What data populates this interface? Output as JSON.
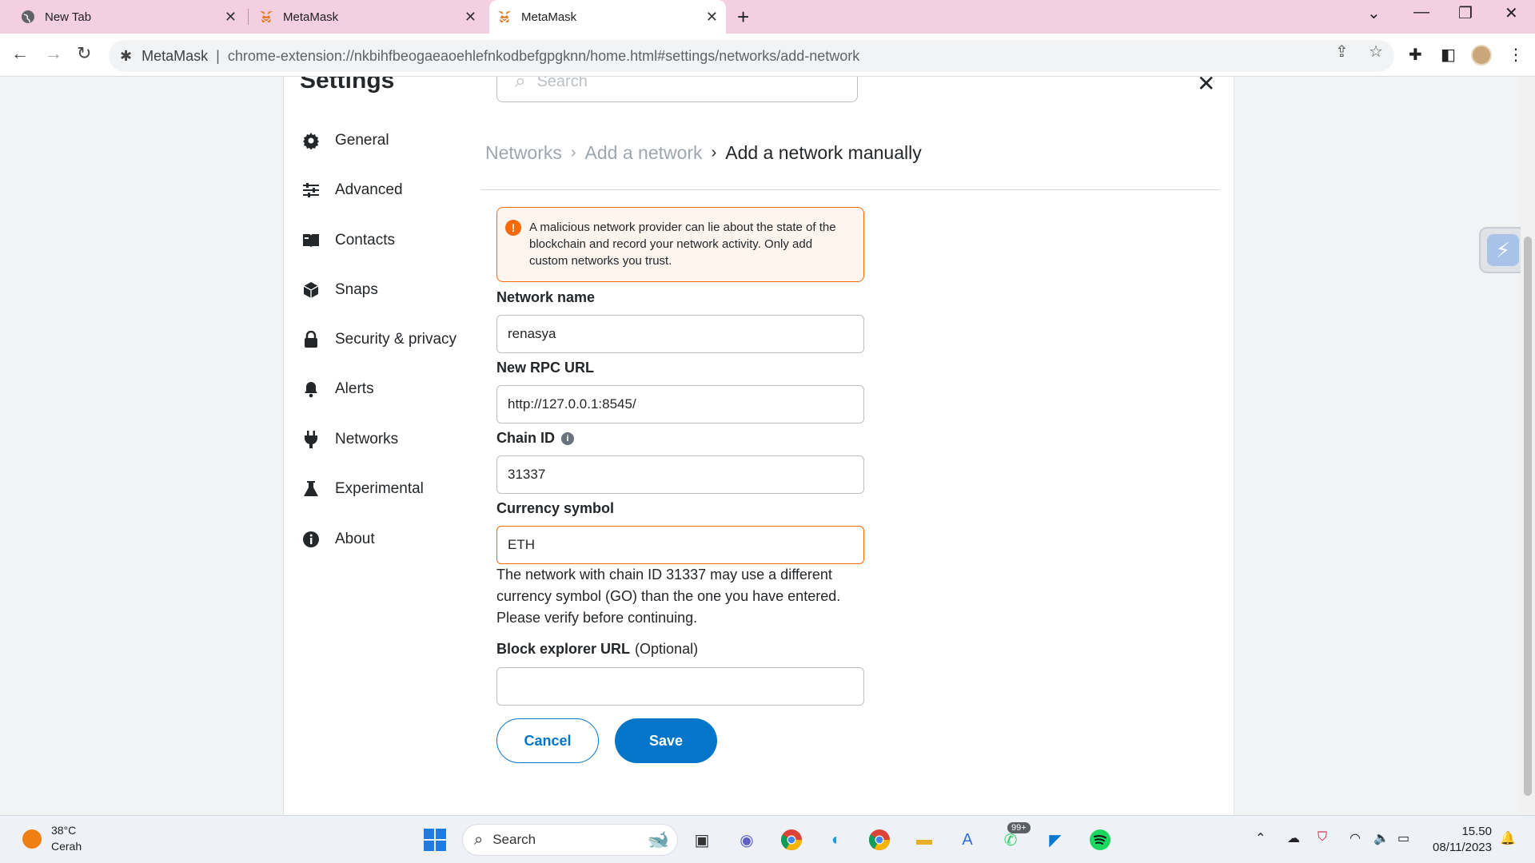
{
  "browser": {
    "tabs": [
      {
        "label": "New Tab"
      },
      {
        "label": "MetaMask"
      },
      {
        "label": "MetaMask"
      }
    ],
    "omnibox": {
      "site": "MetaMask",
      "url": "chrome-extension://nkbihfbeogaeaoehlefnkodbefgpgknn/home.html#settings/networks/add-network"
    }
  },
  "settings": {
    "title": "Settings",
    "search_placeholder": "Search",
    "nav": [
      {
        "label": "General",
        "icon": "gear-icon"
      },
      {
        "label": "Advanced",
        "icon": "sliders-icon"
      },
      {
        "label": "Contacts",
        "icon": "book-icon"
      },
      {
        "label": "Snaps",
        "icon": "cube-icon"
      },
      {
        "label": "Security & privacy",
        "icon": "lock-icon"
      },
      {
        "label": "Alerts",
        "icon": "bell-icon"
      },
      {
        "label": "Networks",
        "icon": "plug-icon"
      },
      {
        "label": "Experimental",
        "icon": "flask-icon"
      },
      {
        "label": "About",
        "icon": "info-icon"
      }
    ]
  },
  "breadcrumb": {
    "first": "Networks",
    "second": "Add a network",
    "current": "Add a network manually"
  },
  "warning": "A malicious network provider can lie about the state of the blockchain and record your network activity. Only add custom networks you trust.",
  "form": {
    "network_name_label": "Network name",
    "network_name_value": "renasya",
    "rpc_label": "New RPC URL",
    "rpc_value": "http://127.0.0.1:8545/",
    "chain_id_label": "Chain ID",
    "chain_id_value": "31337",
    "currency_label": "Currency symbol",
    "currency_value": "ETH",
    "currency_warning": "The network with chain ID 31337 may use a different currency symbol (GO) than the one you have entered. Please verify before continuing.",
    "explorer_label": "Block explorer URL",
    "explorer_optional": "(Optional)",
    "explorer_value": "",
    "cancel_label": "Cancel",
    "save_label": "Save"
  },
  "taskbar": {
    "temperature": "38°C",
    "weather": "Cerah",
    "search_label": "Search",
    "whatsapp_badge": "99+",
    "time": "15.50",
    "date": "08/11/2023"
  },
  "colors": {
    "accent": "#0376c9",
    "warning": "#f66a0a",
    "tabbar": "#f4cfe1"
  }
}
